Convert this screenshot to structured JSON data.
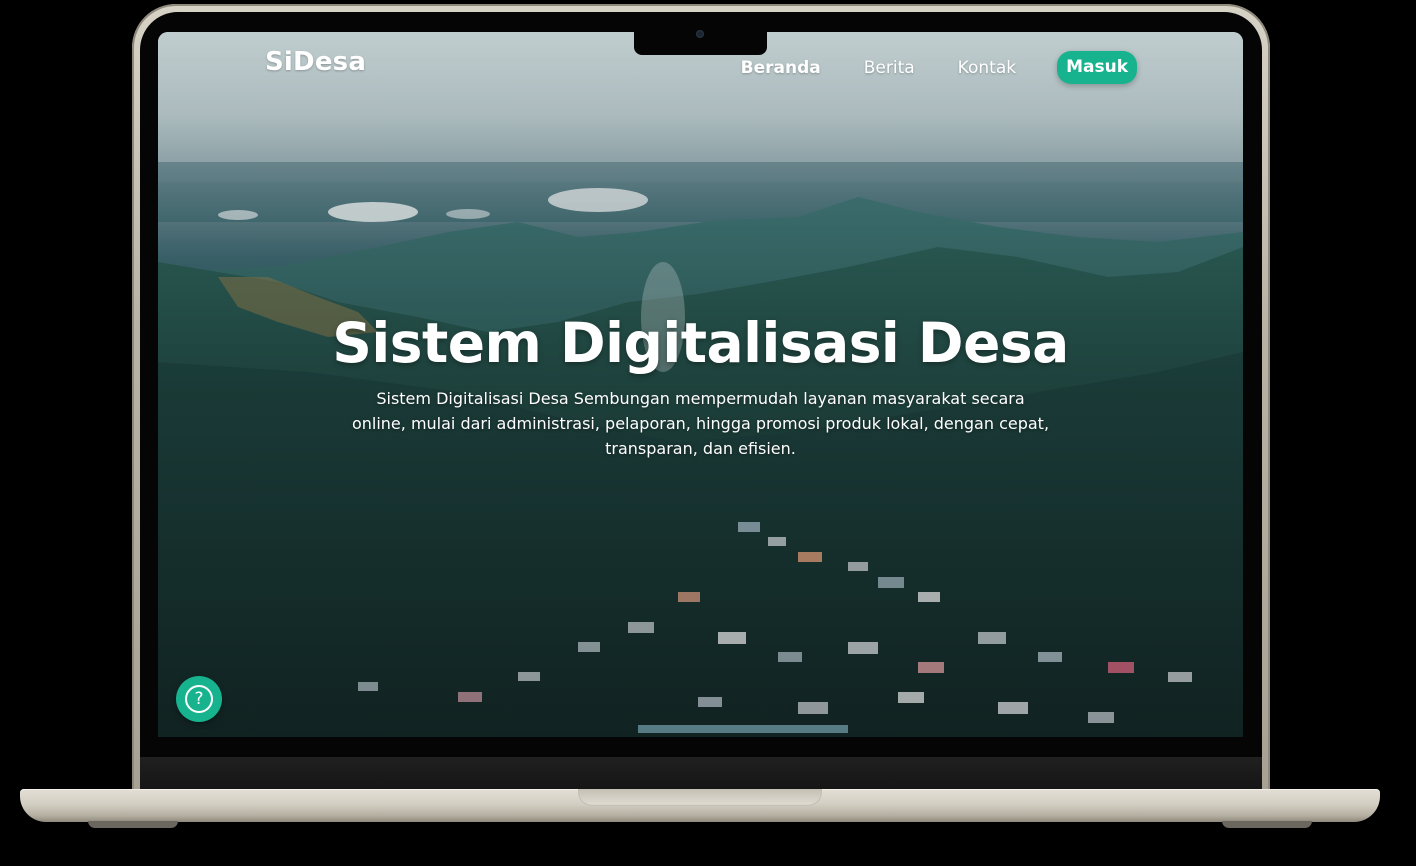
{
  "brand": {
    "name": "SiDesa"
  },
  "nav": {
    "items": [
      {
        "label": "Beranda",
        "active": true
      },
      {
        "label": "Berita",
        "active": false
      },
      {
        "label": "Kontak",
        "active": false
      }
    ],
    "login_label": "Masuk"
  },
  "hero": {
    "title": "Sistem Digitalisasi Desa",
    "subtitle": "Sistem Digitalisasi Desa Sembungan mempermudah layanan masyarakat secara online, mulai dari administrasi, pelaporan, hingga promosi produk lokal, dengan cepat, transparan, dan efisien."
  },
  "help": {
    "icon": "help-icon",
    "glyph": "?"
  },
  "colors": {
    "accent": "#17b38f",
    "text": "#ffffff",
    "laptop_frame": "#d4cfc3"
  }
}
